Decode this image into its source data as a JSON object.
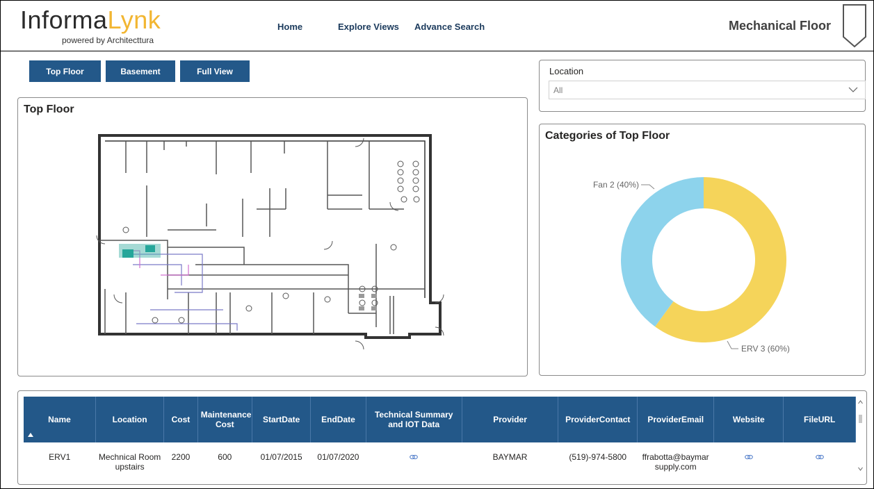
{
  "brand": {
    "name_part1": "Informa",
    "name_part2": "Lynk",
    "tagline": "powered by Architecttura",
    "accent": "#f2b632"
  },
  "nav": [
    {
      "label": "Home"
    },
    {
      "label": "Explore Views"
    },
    {
      "label": "Advance Search"
    }
  ],
  "page": {
    "heading": "Mechanical Floor"
  },
  "buttons": {
    "top_floor": "Top Floor",
    "basement": "Basement",
    "full_view": "Full View"
  },
  "floorplan": {
    "title": "Top Floor"
  },
  "slicer": {
    "label": "Location",
    "value": "All"
  },
  "donut": {
    "title": "Categories of Top Floor",
    "slices": [
      {
        "label": "Fan 2 (40%)",
        "value": 40,
        "color": "#8dd3ec"
      },
      {
        "label": "ERV 3 (60%)",
        "value": 60,
        "color": "#f5d45a"
      }
    ]
  },
  "table": {
    "columns": [
      "Name",
      "Location",
      "Cost",
      "Maintenance Cost",
      "StartDate",
      "EndDate",
      "Technical Summary and IOT Data",
      "Provider",
      "ProviderContact",
      "ProviderEmail",
      "Website",
      "FileURL"
    ],
    "rows": [
      {
        "name": "ERV1",
        "location": "Mechnical Room upstairs",
        "cost": "2200",
        "maintenance_cost": "600",
        "start_date": "01/07/2015",
        "end_date": "01/07/2020",
        "provider": "BAYMAR",
        "provider_contact": "(519)-974-5800",
        "provider_email": "ffrabotta@baymarsupply.com"
      }
    ],
    "header_color": "#235889"
  },
  "icons": {
    "link": "link-icon",
    "chevron": "chevron-down-icon",
    "sort": "sort-ascending-icon",
    "shield": "shield-icon"
  }
}
